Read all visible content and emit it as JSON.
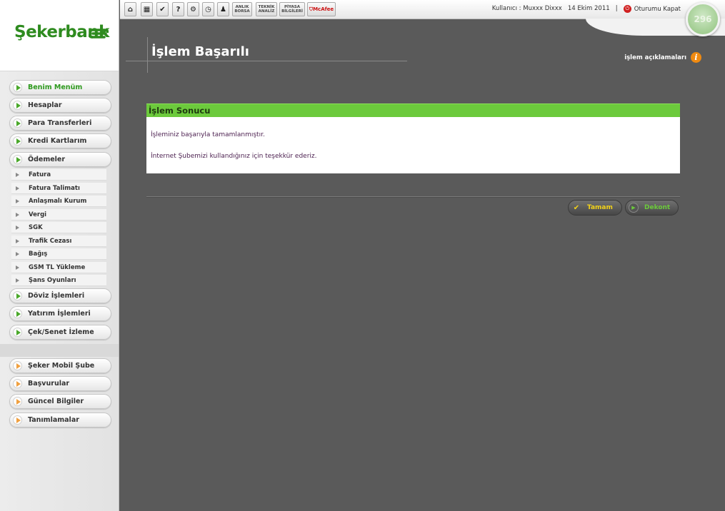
{
  "brand": {
    "logo_text": "Şekerbank"
  },
  "topbar": {
    "buttons": [
      {
        "name": "home-icon",
        "glyph": "⌂"
      },
      {
        "name": "calculator-icon",
        "glyph": "▦"
      },
      {
        "name": "check-icon",
        "glyph": "✔"
      },
      {
        "name": "help-icon",
        "glyph": "?"
      },
      {
        "name": "tools-icon",
        "glyph": "⚙"
      },
      {
        "name": "clock-icon",
        "glyph": "◷"
      },
      {
        "name": "user-icon",
        "glyph": "♟"
      }
    ],
    "text_buttons": [
      "ANLIK BORSA",
      "TEKNİK ANALİZ",
      "PİYASA BİLGİLERİ"
    ],
    "mcafee": "McAfee",
    "user_label": "Kullanıcı : Muxxx Dixxx",
    "date": "14 Ekim 2011",
    "separator": "|",
    "logout": "Oturumu Kapat",
    "timer": "296"
  },
  "page": {
    "title": "İşlem Başarılı",
    "help_label": "işlem açıklamaları"
  },
  "result": {
    "header": "İşlem Sonucu",
    "message1": "İşleminiz başarıyla tamamlanmıştır.",
    "message2": "İnternet Şubemizi kullandığınız için teşekkür ederiz."
  },
  "actions": {
    "ok": "Tamam",
    "receipt": "Dekont"
  },
  "sidebar": {
    "main": [
      {
        "label": "Benim Menüm"
      },
      {
        "label": "Hesaplar"
      },
      {
        "label": "Para Transferleri"
      },
      {
        "label": "Kredi Kartlarım"
      },
      {
        "label": "Ödemeler"
      }
    ],
    "sub": [
      {
        "label": "Fatura"
      },
      {
        "label": "Fatura Talimatı"
      },
      {
        "label": "Anlaşmalı Kurum"
      },
      {
        "label": "Vergi"
      },
      {
        "label": "SGK"
      },
      {
        "label": "Trafik Cezası"
      },
      {
        "label": "Bağış"
      },
      {
        "label": "GSM TL Yükleme"
      },
      {
        "label": "Şans Oyunları"
      }
    ],
    "main2": [
      {
        "label": "Döviz İşlemleri"
      },
      {
        "label": "Yatırım İşlemleri"
      },
      {
        "label": "Çek/Senet İzleme"
      }
    ],
    "extra": [
      {
        "label": "Şeker Mobil Şube"
      },
      {
        "label": "Başvurular"
      },
      {
        "label": "Güncel Bilgiler"
      },
      {
        "label": "Tanımlamalar"
      }
    ]
  },
  "colors": {
    "brand_green": "#2e8b1f",
    "panel_header": "#6cca3c",
    "ok_accent": "#f2d21a",
    "receipt_accent": "#6cca3c"
  }
}
